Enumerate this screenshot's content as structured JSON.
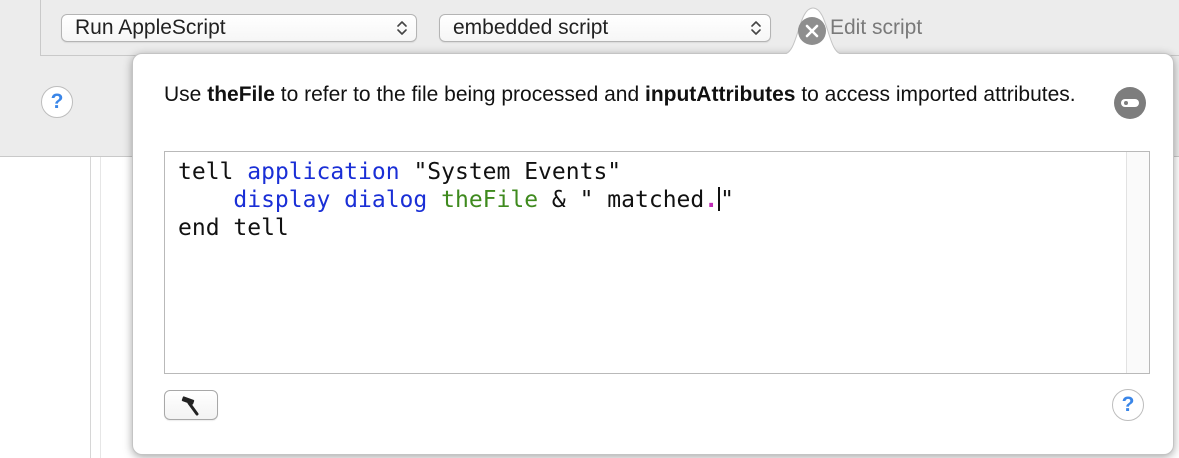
{
  "action_row": {
    "action_popup": "Run AppleScript",
    "source_popup": "embedded script",
    "edit_label": "Edit script",
    "help_label": "?"
  },
  "popover": {
    "description": {
      "use_word": "Use",
      "var_file": "theFile",
      "mid_text": "to refer to the file being processed and",
      "var_attrs": "inputAttributes",
      "end_text": "to access imported attributes."
    },
    "code": {
      "line1": {
        "w1": "tell",
        "w2": "application",
        "w3": "\"System Events\""
      },
      "line2": {
        "indent": "    ",
        "w1": "display dialog",
        "w2": "theFile",
        "w3": "& \" matched",
        "w4": ".",
        "w5": "\""
      },
      "line3": {
        "w1": "end tell"
      }
    },
    "help_label": "?"
  },
  "icons": {
    "close": "close-circle-icon",
    "detach": "detach-icon",
    "build": "hammer-icon",
    "chevrons": "up-down-chevron-icon"
  },
  "colors": {
    "keyword_application": "#1a2fd6",
    "variable": "#3f8a1e",
    "punctuation_highlight": "#c02bb6",
    "help_blue": "#3a86e8"
  }
}
